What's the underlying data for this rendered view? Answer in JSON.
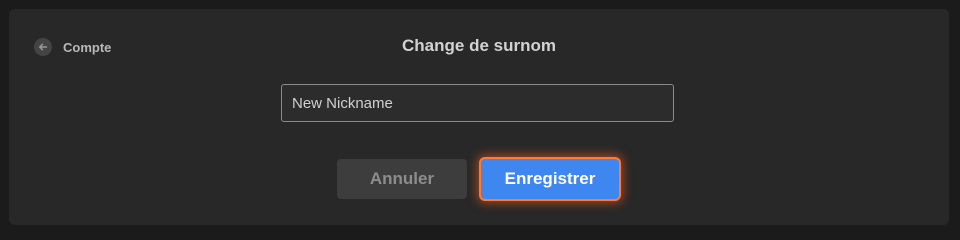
{
  "header": {
    "back_label": "Compte",
    "title": "Change de surnom"
  },
  "form": {
    "nickname_value": "New Nickname"
  },
  "actions": {
    "cancel_label": "Annuler",
    "save_label": "Enregistrer"
  },
  "icons": {
    "back": "arrow-left-icon"
  },
  "colors": {
    "background": "#1b1b1b",
    "panel": "#282828",
    "primary": "#3f87f0",
    "focus_glow": "#ff7a35",
    "cancel_bg": "#3d3d3d"
  }
}
